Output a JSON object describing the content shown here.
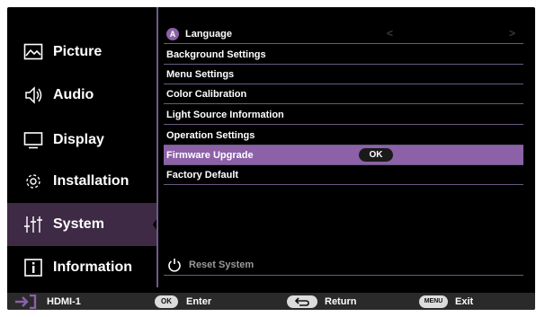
{
  "left_menu": {
    "items": [
      {
        "label": "Picture",
        "icon": "picture-icon"
      },
      {
        "label": "Audio",
        "icon": "speaker-icon"
      },
      {
        "label": "Display",
        "icon": "monitor-icon"
      },
      {
        "label": "Installation",
        "icon": "gear-icon"
      },
      {
        "label": "System",
        "icon": "sliders-icon"
      },
      {
        "label": "Information",
        "icon": "info-icon"
      }
    ],
    "active": "System"
  },
  "right_menu": {
    "language": {
      "label": "Language",
      "icon_letter": "A",
      "prev_arrow": "<",
      "next_arrow": ">"
    },
    "items": [
      {
        "label": "Background Settings"
      },
      {
        "label": "Menu Settings"
      },
      {
        "label": "Color Calibration"
      },
      {
        "label": "Light Source Information"
      },
      {
        "label": "Operation Settings"
      },
      {
        "label": "Firmware Upgrade",
        "action": "OK"
      },
      {
        "label": "Factory Default"
      }
    ],
    "selected": "Firmware Upgrade",
    "reset": {
      "label": "Reset System"
    }
  },
  "footer": {
    "source": "HDMI-1",
    "enter_key": "OK",
    "enter_label": "Enter",
    "return_label": "Return",
    "exit_key": "MENU",
    "exit_label": "Exit"
  },
  "colors": {
    "accent": "#8c61a8",
    "active_bg": "#3e2a45",
    "divider": "#6e5a88",
    "footer_bg": "#2a2a2a"
  }
}
